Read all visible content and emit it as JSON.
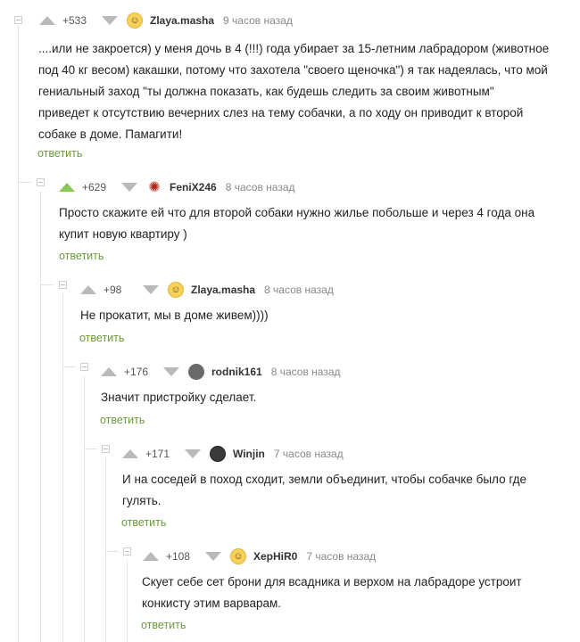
{
  "comments": [
    {
      "rating": "+533",
      "username": "Zlaya.masha",
      "time": "9 часов назад",
      "text_lines": [
        "....или не закроется) у меня дочь в 4 (!!!) года убирает за 15-летним лабрадором (животное",
        "под 40 кг весом) какашки, потому что захотела \"своего щеночка\") я так надеялась, что мой",
        "гениальный заход \"ты должна показать, как будешь следить за своим животным\"",
        "приведет к отсутствию вечерних слез на тему собачки, а по ходу он приводит к второй",
        "собаке в доме. Памагити!"
      ],
      "reply": "ответить",
      "avatar": "smiley-face-avatar",
      "upvoted": false
    },
    {
      "rating": "+629",
      "username": "FeniX246",
      "time": "8 часов назад",
      "text_lines": [
        "Просто скажите ей что для второй собаки нужно жилье побольше и через 4 года она",
        "купит новую квартиру )"
      ],
      "reply": "ответить",
      "avatar": "dragon-avatar",
      "upvoted": true
    },
    {
      "rating": "+98",
      "username": "Zlaya.masha",
      "time": "8 часов назад",
      "text_lines": [
        "Не прокатит, мы в доме живем))))"
      ],
      "reply": "ответить",
      "avatar": "smiley-face-avatar",
      "upvoted": false
    },
    {
      "rating": "+176",
      "username": "rodnik161",
      "time": "8 часов назад",
      "text_lines": [
        "Значит пристройку сделает."
      ],
      "reply": "ответить",
      "avatar": "photo-avatar",
      "upvoted": false
    },
    {
      "rating": "+171",
      "username": "Winjin",
      "time": "7 часов назад",
      "text_lines": [
        "И на соседей в поход сходит, земли объединит, чтобы собачке было где",
        "гулять."
      ],
      "reply": "ответить",
      "avatar": "dark-avatar",
      "upvoted": false
    },
    {
      "rating": "+108",
      "username": "XepHiR0",
      "time": "7 часов назад",
      "text_lines": [
        "Скует себе сет брони для всадника и верхом на лабрадоре устроит",
        "конкисту этим варварам."
      ],
      "reply": "ответить",
      "avatar": "smiley-face-avatar",
      "upvoted": false
    }
  ],
  "colors": {
    "upvote_active": "#8ac858",
    "arrow_inactive": "#b9b9b9",
    "reply_link": "#6b9a3a",
    "thread_line": "#e4e4e4"
  }
}
